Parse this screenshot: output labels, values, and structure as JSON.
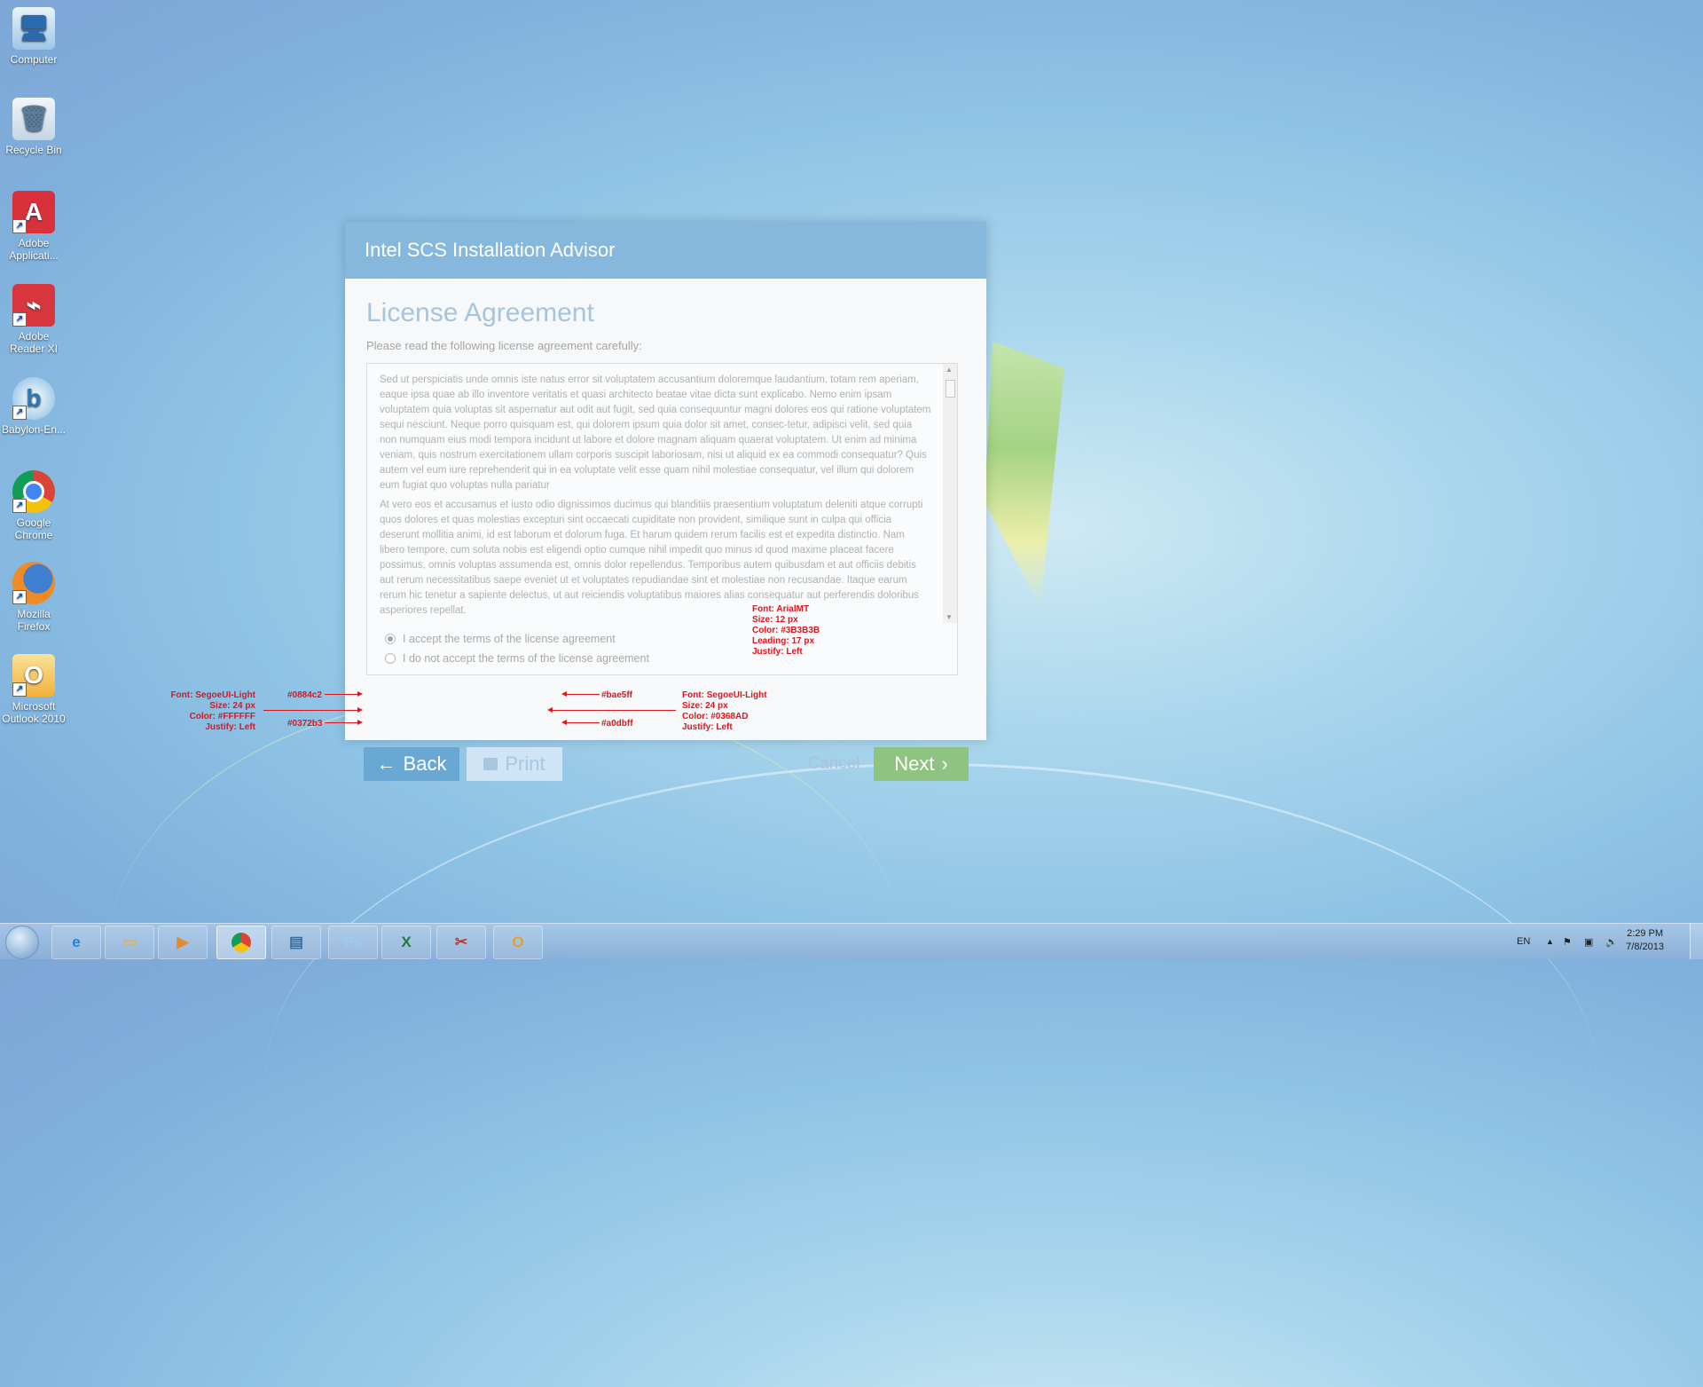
{
  "desktop": {
    "icons": [
      {
        "label_l1": "Computer",
        "label_l2": "",
        "icon": "computer-icon"
      },
      {
        "label_l1": "Recycle Bin",
        "label_l2": "",
        "icon": "recycle-bin-icon"
      },
      {
        "label_l1": "Adobe",
        "label_l2": "Applicati...",
        "icon": "adobe-application-manager-icon"
      },
      {
        "label_l1": "Adobe",
        "label_l2": "Reader XI",
        "icon": "adobe-reader-icon"
      },
      {
        "label_l1": "Babylon-En...",
        "label_l2": "",
        "icon": "babylon-icon"
      },
      {
        "label_l1": "Google",
        "label_l2": "Chrome",
        "icon": "chrome-icon"
      },
      {
        "label_l1": "Mozilla",
        "label_l2": "Firefox",
        "icon": "firefox-icon"
      },
      {
        "label_l1": "Microsoft",
        "label_l2": "Outlook 2010",
        "icon": "outlook-icon"
      }
    ]
  },
  "dialog": {
    "title": "Intel SCS Installation Advisor",
    "heading": "License Agreement",
    "subheading": "Please read the following license agreement carefully:",
    "license_paragraphs": [
      "Sed ut perspiciatis unde omnis iste natus error sit voluptatem accusantium doloremque laudantium, totam rem aperiam, eaque ipsa quae ab illo inventore veritatis et quasi architecto beatae vitae dicta sunt explicabo. Nemo enim ipsam voluptatem quia voluptas sit aspernatur aut odit aut fugit, sed quia consequuntur magni dolores eos qui ratione voluptatem sequi nesciunt. Neque porro quisquam est, qui dolorem ipsum quia dolor sit amet, consec-tetur, adipisci velit, sed quia non numquam eius modi tempora incidunt ut labore et dolore magnam aliquam quaerat voluptatem. Ut enim ad minima veniam, quis nostrum exercitationem ullam corporis suscipit laboriosam, nisi ut aliquid ex ea commodi consequatur? Quis autem vel eum iure reprehenderit qui in ea voluptate velit esse quam nihil molestiae consequatur, vel illum qui dolorem eum fugiat quo voluptas nulla pariatur",
      "At vero eos et accusamus et iusto odio dignissimos ducimus qui blanditiis praesentium voluptatum deleniti atque corrupti quos dolores et quas molestias excepturi sint occaecati cupiditate non provident, similique sunt in culpa qui officia deserunt mollitia animi, id est laborum et dolorum fuga. Et harum quidem rerum facilis est et expedita distinctio. Nam libero tempore, cum soluta nobis est eligendi optio cumque nihil impedit quo minus id quod maxime placeat facere possimus, omnis voluptas assumenda est, omnis dolor repellendus. Temporibus autem quibusdam et aut officiis debitis aut rerum necessitatibus saepe eveniet ut et voluptates repudiandae sint et molestiae non recusandae. Itaque earum rerum hic tenetur a sapiente delectus, ut aut reiciendis voluptatibus maiores alias consequatur aut perferendis doloribus asperiores repellat."
    ],
    "radio_accept": "I accept the terms of the license agreement",
    "radio_decline": "I do not accept the terms of the license agreement",
    "radio_selected": "accept",
    "buttons": {
      "back": "Back",
      "back_icon": "←",
      "print": "Print",
      "cancel": "Cancel",
      "next": "Next",
      "next_icon": "›"
    },
    "colors": {
      "title_bar": "#86b8dd",
      "back_button": "#6aa8d4",
      "print_button": "#cfe4f4",
      "next_button": "#8fc382"
    }
  },
  "annotations": {
    "left_spec": [
      "Font: SegoeUI-Light",
      "Size: 24 px",
      "Color: #FFFFFF",
      "Justify: Left"
    ],
    "back_top_color": "#0884c2",
    "back_bottom_color": "#0372b3",
    "print_top_color": "#bae5ff",
    "print_bottom_color": "#a0dbff",
    "right_spec": [
      "Font: SegoeUI-Light",
      "Size: 24 px",
      "Color: #0368AD",
      "Justify: Left"
    ],
    "text_spec": [
      "Font: ArialMT",
      "Size: 12 px",
      "Color: #3B3B3B",
      "Leading: 17 px",
      "Justify: Left"
    ]
  },
  "taskbar": {
    "apps": [
      "internet-explorer-icon",
      "file-explorer-icon",
      "media-player-icon",
      "chrome-icon",
      "task-manager-icon",
      "photoshop-icon",
      "excel-icon",
      "snipping-tool-icon",
      "outlook-icon"
    ],
    "photoshop_label": "Ps",
    "excel_label": "X",
    "language": "EN",
    "time": "2:29 PM",
    "date": "7/8/2013"
  }
}
